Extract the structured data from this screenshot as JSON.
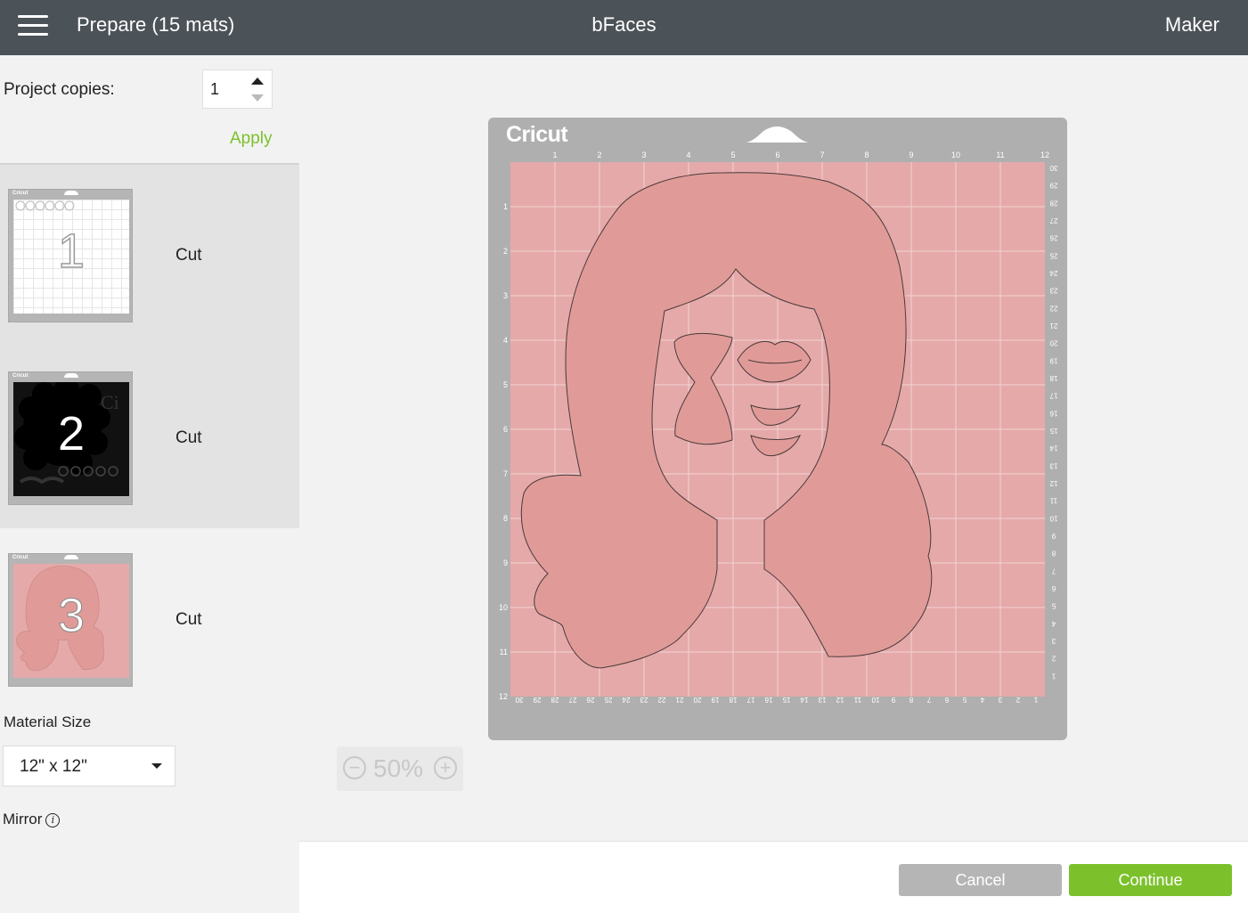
{
  "header": {
    "title": "Prepare (15 mats)",
    "project_name": "bFaces",
    "machine": "Maker"
  },
  "sidebar": {
    "copies_label": "Project copies:",
    "copies_value": "1",
    "apply_label": "Apply",
    "mats": [
      {
        "number": "1",
        "label": "Cut",
        "color": "#ffffff"
      },
      {
        "number": "2",
        "label": "Cut",
        "color": "#111111"
      },
      {
        "number": "3",
        "label": "Cut",
        "color": "#e5a9a9"
      }
    ],
    "material_size_label": "Material Size",
    "material_size_value": "12\" x 12\"",
    "mirror_label": "Mirror"
  },
  "canvas": {
    "brand": "Cricut",
    "material_color": "#e5a9a9",
    "cut_color": "#e09b98",
    "top_ruler": [
      "1",
      "2",
      "3",
      "4",
      "5",
      "6",
      "7",
      "8",
      "9",
      "10",
      "11",
      "12"
    ],
    "left_ruler": [
      "1",
      "2",
      "3",
      "4",
      "5",
      "6",
      "7",
      "8",
      "9",
      "10",
      "11",
      "12"
    ],
    "right_ruler": [
      "30",
      "29",
      "28",
      "27",
      "26",
      "25",
      "24",
      "23",
      "22",
      "21",
      "20",
      "19",
      "18",
      "17",
      "16",
      "15",
      "14",
      "13",
      "12",
      "11",
      "10",
      "9",
      "8",
      "7",
      "6",
      "5",
      "4",
      "3",
      "2",
      "1"
    ],
    "bottom_ruler": [
      "30",
      "29",
      "28",
      "27",
      "26",
      "25",
      "24",
      "23",
      "22",
      "21",
      "20",
      "19",
      "18",
      "17",
      "16",
      "15",
      "14",
      "13",
      "12",
      "11",
      "10",
      "9",
      "8",
      "7",
      "6",
      "5",
      "4",
      "3",
      "2",
      "1"
    ],
    "zoom": "50%"
  },
  "footer": {
    "cancel_label": "Cancel",
    "continue_label": "Continue"
  },
  "colors": {
    "header_bg": "#4b5258",
    "accent_green": "#7cc12c",
    "mat_gray": "#afafaf"
  }
}
